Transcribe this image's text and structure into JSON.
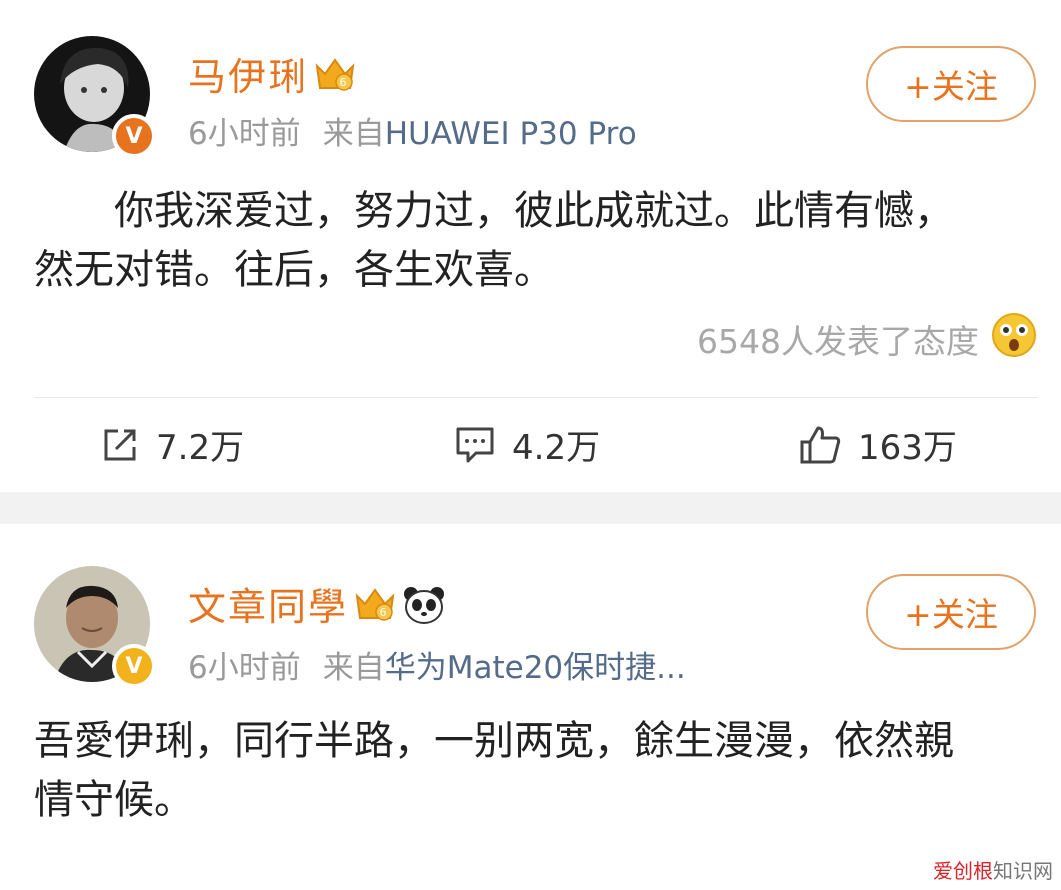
{
  "post1": {
    "username": "马伊琍",
    "time": "6小时前",
    "from_label": "来自",
    "source": "HUAWEI P30 Pro",
    "follow_label": "+关注",
    "text_line1": "你我深爱过，努力过，彼此成就过。此情有憾，",
    "text_line2": "然无对错。往后，各生欢喜。",
    "reactions_text": "6548人发表了态度",
    "share_count": "7.2万",
    "comment_count": "4.2万",
    "like_count": "163万"
  },
  "post2": {
    "username": "文章同學",
    "time": "6小时前",
    "from_label": "来自",
    "source": "华为Mate20保时捷...",
    "follow_label": "+关注",
    "text_line1": "吾愛伊琍，同行半路，一别两宽，餘生漫漫，依然親",
    "text_line2": "情守候。"
  },
  "watermark": {
    "brand": "爱创根",
    "suffix": "知识网"
  },
  "colors": {
    "accent": "#e8731f",
    "source_link": "#556b8a",
    "meta_gray": "#9a9a9a"
  },
  "icons": [
    "share-icon",
    "comment-icon",
    "like-icon",
    "crown-icon",
    "panda-icon",
    "surprised-emoji-icon",
    "verified-badge-icon"
  ]
}
